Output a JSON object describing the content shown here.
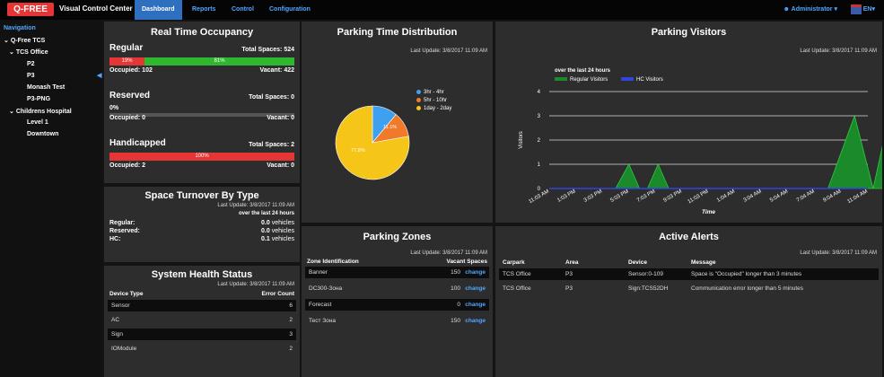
{
  "topbar": {
    "logo": "Q-FREE",
    "app_name": "Visual Control Center",
    "tabs": [
      "Dashboard",
      "Reports",
      "Control",
      "Configuration"
    ],
    "user": "Administrator ▾",
    "lang": "EN▾"
  },
  "sidebar": {
    "heading": "Navigation",
    "items": [
      "Q-Free TCS",
      "TCS Office",
      "P2",
      "P3",
      "Monash Test",
      "P3-PNG",
      "Childrens Hospital",
      "Level 1",
      "Downtown"
    ]
  },
  "occupancy": {
    "title": "Real Time Occupancy",
    "regular": {
      "name": "Regular",
      "total": "Total Spaces: 524",
      "occ_pct": "19%",
      "vac_pct": "81%",
      "occupied_frac": 0.19,
      "occupied": "Occupied: 102",
      "vacant": "Vacant: 422"
    },
    "reserved": {
      "name": "Reserved",
      "total": "Total Spaces: 0",
      "pct": "0%",
      "occupied": "Occupied: 0",
      "vacant": "Vacant: 0"
    },
    "handicapped": {
      "name": "Handicapped",
      "total": "Total Spaces: 2",
      "pct": "100%",
      "occupied": "Occupied: 2",
      "vacant": "Vacant: 0"
    }
  },
  "turnover": {
    "title": "Space Turnover By Type",
    "updated": "Last Update: 3/8/2017 11:09 AM",
    "period": "over the last 24 hours",
    "rows": [
      {
        "label": "Regular:",
        "value": "0.0",
        "unit": "vehicles"
      },
      {
        "label": "Reserved:",
        "value": "0.0",
        "unit": "vehicles"
      },
      {
        "label": "HC:",
        "value": "0.1",
        "unit": "vehicles"
      }
    ]
  },
  "health": {
    "title": "System Health Status",
    "updated": "Last Update: 3/8/2017 11:09 AM",
    "col1": "Device Type",
    "col2": "Error Count",
    "rows": [
      {
        "device": "Sensor",
        "count": "6"
      },
      {
        "device": "AC",
        "count": "2"
      },
      {
        "device": "Sign",
        "count": "3"
      },
      {
        "device": "IOModule",
        "count": "2"
      }
    ]
  },
  "distribution": {
    "title": "Parking Time Distribution",
    "updated": "Last Update: 3/8/2017 11:09 AM",
    "legend": [
      "3hr - 4hr",
      "5hr - 10hr",
      "1day - 2day"
    ],
    "slice_labels": [
      "11.1%",
      "77.8%"
    ]
  },
  "zones": {
    "title": "Parking Zones",
    "updated": "Last Update: 3/8/2017 11:09 AM",
    "col1": "Zone Identification",
    "col2": "Vacant Spaces",
    "change": "change",
    "rows": [
      {
        "zone": "Banner",
        "vacant": "150"
      },
      {
        "zone": "DC300-Зона",
        "vacant": "100"
      },
      {
        "zone": "Forecast",
        "vacant": "0"
      },
      {
        "zone": "Тест Зона",
        "vacant": "150"
      }
    ]
  },
  "visitors": {
    "title": "Parking Visitors",
    "updated": "Last Update: 3/8/2017 11:09 AM",
    "period": "over the last 24 hours",
    "ylabel": "Visitors",
    "xlabel": "Time"
  },
  "alerts": {
    "title": "Active Alerts",
    "updated": "Last Update: 3/8/2017 11:09 AM",
    "cols": [
      "Carpark",
      "Area",
      "Device",
      "Message"
    ],
    "rows": [
      {
        "carpark": "TCS Office",
        "area": "P3",
        "device": "Sensor:0-109",
        "message": "Space is \"Occupied\" longer than 3 minutes"
      },
      {
        "carpark": "TCS Office",
        "area": "P3",
        "device": "Sign:TCS52DH",
        "message": "Communication error longer than 5 minutes"
      }
    ]
  },
  "colors": {
    "accent": "#2f6fc0",
    "link": "#4fa8ff",
    "occupied": "#e63535",
    "vacant": "#2fb82f",
    "regular_series": "#1a8a2a",
    "hc_series": "#3344dd"
  },
  "chart_data": [
    {
      "type": "pie",
      "title": "Parking Time Distribution",
      "categories": [
        "3hr - 4hr",
        "5hr - 10hr",
        "1day - 2day"
      ],
      "values": [
        11.1,
        11.1,
        77.8
      ],
      "colors": [
        "#3fa0ef",
        "#f07a2a",
        "#f5c518"
      ],
      "legend": "top-right"
    },
    {
      "type": "area",
      "title": "Parking Visitors",
      "subtitle": "over the last 24 hours",
      "xlabel": "Time",
      "ylabel": "Visitors",
      "x": [
        "11:03 AM",
        "1:03 PM",
        "3:03 PM",
        "5:03 PM",
        "7:03 PM",
        "9:03 PM",
        "11:03 PM",
        "1:04 AM",
        "3:04 AM",
        "5:04 AM",
        "7:04 AM",
        "9:04 AM",
        "11:04 AM"
      ],
      "ylim": [
        0,
        4
      ],
      "yticks": [
        0,
        1,
        2,
        3,
        4
      ],
      "grid": true,
      "legend": "top-left",
      "series": [
        {
          "name": "Regular Visitors",
          "color": "#1a8a2a",
          "points": [
            [
              0,
              0
            ],
            [
              2.5,
              0
            ],
            [
              3,
              1
            ],
            [
              3.4,
              0
            ],
            [
              3.7,
              0
            ],
            [
              4.1,
              1
            ],
            [
              4.5,
              0
            ],
            [
              10.5,
              0
            ],
            [
              11.5,
              3
            ],
            [
              12.2,
              0
            ],
            [
              12.6,
              2
            ],
            [
              13,
              2
            ],
            [
              14,
              0
            ]
          ]
        },
        {
          "name": "HC Visitors",
          "color": "#3344dd",
          "points": [
            [
              0,
              0
            ],
            [
              14,
              0
            ]
          ]
        }
      ]
    }
  ]
}
